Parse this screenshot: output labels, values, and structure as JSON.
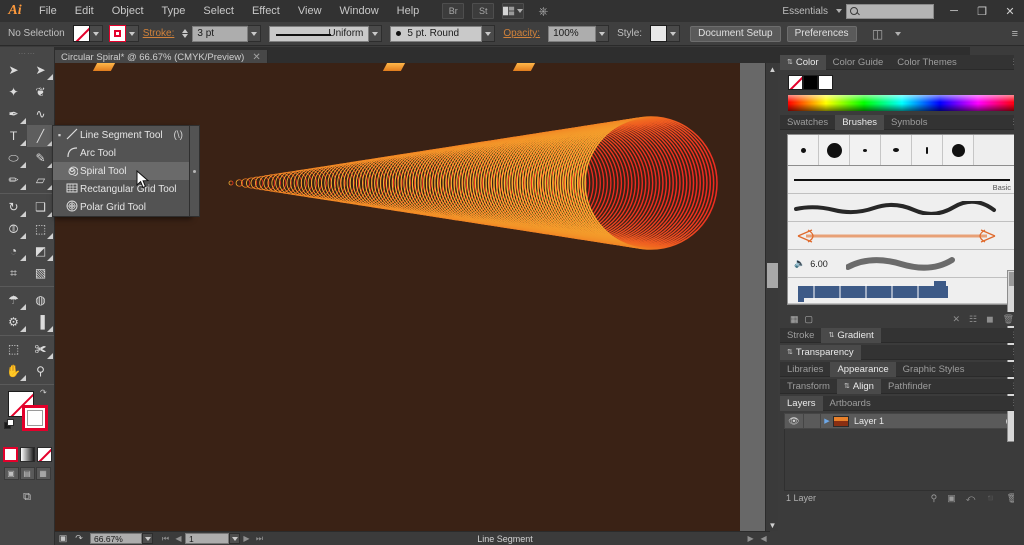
{
  "app": {
    "name": "Adobe Illustrator",
    "logo": "Ai"
  },
  "menubar": {
    "items": [
      "File",
      "Edit",
      "Object",
      "Type",
      "Select",
      "Effect",
      "View",
      "Window",
      "Help"
    ],
    "icons": [
      "bridge-icon",
      "stock-icon",
      "arrange-documents-icon",
      "workspace-switcher-icon"
    ],
    "bridge_label": "Br",
    "stock_label": "St",
    "workspace": "Essentials",
    "search_placeholder": "",
    "window_controls": {
      "minimize": "─",
      "restore": "❐",
      "close": "✕"
    }
  },
  "controlbar": {
    "selection_status": "No Selection",
    "fill_label": "fill-swatch",
    "stroke_label": "stroke-swatch",
    "stroke_text": "Stroke:",
    "stroke_weight": "3 pt",
    "profile": "Uniform",
    "brush_definition": "5 pt. Round",
    "opacity_text": "Opacity:",
    "opacity_value": "100%",
    "style_text": "Style:",
    "document_setup": "Document Setup",
    "preferences": "Preferences",
    "panel_menu": "≡"
  },
  "document": {
    "tab_title": "Circular Spiral* @ 66.67% (CMYK/Preview)",
    "tab_close": "✕",
    "zoom": "66.67%",
    "page": "1",
    "status_text": "Line Segment",
    "canvas_bg": "#3a2215"
  },
  "toolbar": {
    "grip": "⋯⋯",
    "tools": [
      {
        "name": "selection-tool",
        "glyph": "➤",
        "sel": false,
        "menu": false
      },
      {
        "name": "direct-selection-tool",
        "glyph": "➤",
        "sel": false,
        "menu": true
      },
      {
        "name": "magic-wand-tool",
        "glyph": "✦",
        "sel": false,
        "menu": false
      },
      {
        "name": "lasso-tool",
        "glyph": "❦",
        "sel": false,
        "menu": false
      },
      {
        "name": "pen-tool",
        "glyph": "✒",
        "sel": false,
        "menu": true
      },
      {
        "name": "curvature-tool",
        "glyph": "∿",
        "sel": false,
        "menu": false
      },
      {
        "name": "type-tool",
        "glyph": "T",
        "sel": false,
        "menu": true
      },
      {
        "name": "line-segment-tool",
        "glyph": "╱",
        "sel": true,
        "menu": true
      },
      {
        "name": "ellipse-tool",
        "glyph": "⬭",
        "sel": false,
        "menu": true
      },
      {
        "name": "paintbrush-tool",
        "glyph": "✎",
        "sel": false,
        "menu": true
      },
      {
        "name": "pencil-tool",
        "glyph": "✏",
        "sel": false,
        "menu": true
      },
      {
        "name": "eraser-tool",
        "glyph": "▱",
        "sel": false,
        "menu": true
      },
      {
        "name": "rotate-tool",
        "glyph": "↻",
        "sel": false,
        "menu": true
      },
      {
        "name": "scale-tool",
        "glyph": "❑",
        "sel": false,
        "menu": true
      },
      {
        "name": "width-tool",
        "glyph": "⦷",
        "sel": false,
        "menu": true
      },
      {
        "name": "free-transform-tool",
        "glyph": "⬚",
        "sel": false,
        "menu": true
      },
      {
        "name": "shape-builder-tool",
        "glyph": "◔",
        "sel": false,
        "menu": true
      },
      {
        "name": "perspective-grid-tool",
        "glyph": "◩",
        "sel": false,
        "menu": true
      },
      {
        "name": "mesh-tool",
        "glyph": "⌗",
        "sel": false,
        "menu": false
      },
      {
        "name": "gradient-tool",
        "glyph": "▧",
        "sel": false,
        "menu": false
      },
      {
        "name": "eyedropper-tool",
        "glyph": "☂",
        "sel": false,
        "menu": true
      },
      {
        "name": "blend-tool",
        "glyph": "◍",
        "sel": false,
        "menu": false
      },
      {
        "name": "symbol-sprayer-tool",
        "glyph": "⚙",
        "sel": false,
        "menu": true
      },
      {
        "name": "column-graph-tool",
        "glyph": "▐",
        "sel": false,
        "menu": true
      },
      {
        "name": "artboard-tool",
        "glyph": "⬚",
        "sel": false,
        "menu": false
      },
      {
        "name": "slice-tool",
        "glyph": "✀",
        "sel": false,
        "menu": true
      },
      {
        "name": "hand-tool",
        "glyph": "✋",
        "sel": false,
        "menu": true
      },
      {
        "name": "zoom-tool",
        "glyph": "⚲",
        "sel": false,
        "menu": false
      }
    ],
    "fill_stroke": {
      "fill": "none-swatch",
      "stroke": "red-stroke-swatch"
    },
    "fill_modes": [
      "color-mode",
      "gradient-mode",
      "none-mode"
    ],
    "draw_modes": [
      "draw-normal",
      "draw-behind",
      "draw-inside"
    ],
    "screen_mode": "change-screen-mode"
  },
  "flyout": {
    "title": "line-tools-flyout",
    "items": [
      {
        "label": "Line Segment Tool",
        "shortcut": "(\\)",
        "icon": "line-icon",
        "active": false,
        "bullet": true
      },
      {
        "label": "Arc Tool",
        "shortcut": "",
        "icon": "arc-icon",
        "active": false,
        "bullet": false
      },
      {
        "label": "Spiral Tool",
        "shortcut": "",
        "icon": "spiral-icon",
        "active": true,
        "bullet": false
      },
      {
        "label": "Rectangular Grid Tool",
        "shortcut": "",
        "icon": "rect-grid-icon",
        "active": false,
        "bullet": false
      },
      {
        "label": "Polar Grid Tool",
        "shortcut": "",
        "icon": "polar-grid-icon",
        "active": false,
        "bullet": false
      }
    ]
  },
  "panels": {
    "color": {
      "tabs": [
        "Color",
        "Color Guide",
        "Color Themes"
      ],
      "active": "Color",
      "swatches": [
        "none",
        "black",
        "white"
      ]
    },
    "brushes": {
      "tabs": [
        "Swatches",
        "Brushes",
        "Symbols"
      ],
      "active": "Brushes",
      "basic_label": "Basic",
      "bristle_size": "6.00"
    },
    "stroke_gradient": {
      "tabs": [
        "Stroke",
        "Gradient"
      ],
      "active": "Gradient"
    },
    "transparency": {
      "tabs": [
        "Transparency"
      ],
      "active": "Transparency"
    },
    "appearance": {
      "tabs": [
        "Libraries",
        "Appearance",
        "Graphic Styles"
      ],
      "active": "Appearance"
    },
    "align": {
      "tabs": [
        "Transform",
        "Align",
        "Pathfinder"
      ],
      "active": "Align"
    },
    "layers": {
      "tabs": [
        "Layers",
        "Artboards"
      ],
      "active": "Layers",
      "rows": [
        {
          "name": "Layer 1",
          "visible": true,
          "locked": false
        }
      ],
      "footer_count": "1 Layer",
      "footer_icons": [
        "locate-object-icon",
        "make-mask-icon",
        "new-sublayer-icon",
        "new-layer-icon",
        "delete-layer-icon"
      ]
    }
  },
  "artwork": {
    "name": "circular-spiral-cone",
    "ring_count": 120,
    "color_start": "#f5a623",
    "color_end": "#e8242a",
    "ruler_marks": 3
  }
}
